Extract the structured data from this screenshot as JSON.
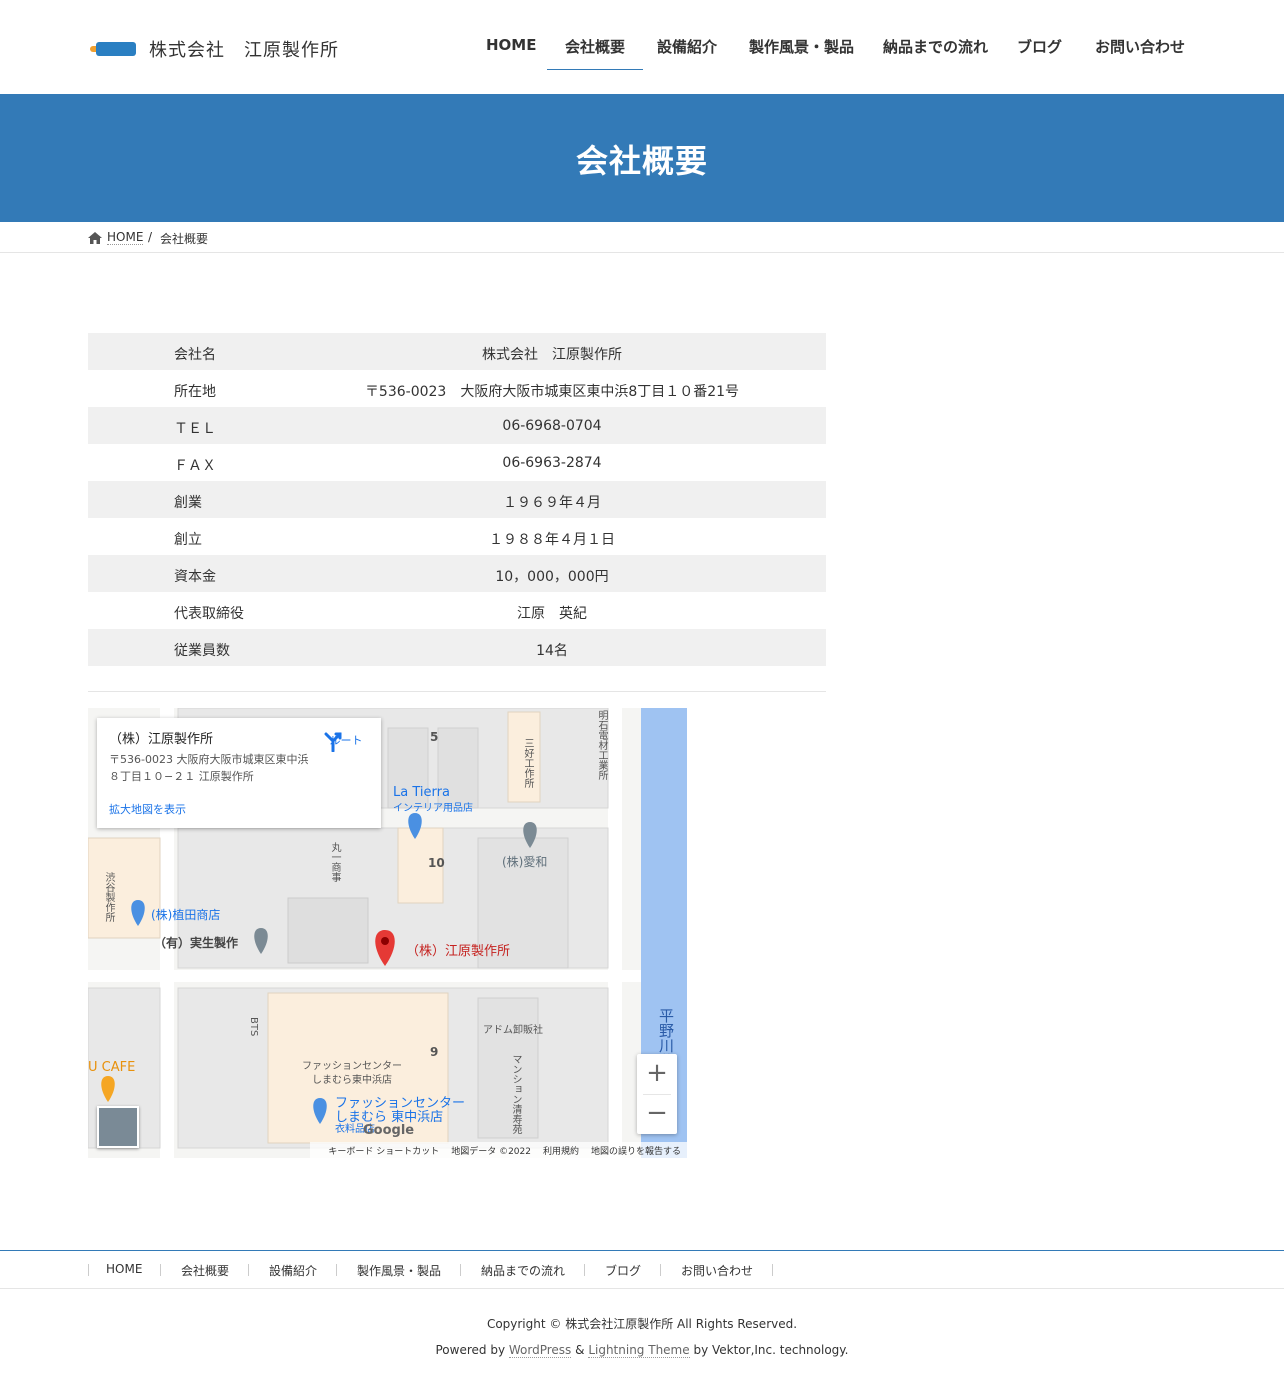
{
  "site": {
    "logo_text": "株式会社　江原製作所"
  },
  "nav": {
    "items": [
      {
        "label": "HOME"
      },
      {
        "label": "会社概要"
      },
      {
        "label": "設備紹介"
      },
      {
        "label": "製作風景・製品"
      },
      {
        "label": "納品までの流れ"
      },
      {
        "label": "ブログ"
      },
      {
        "label": "お問い合わせ"
      }
    ],
    "active": "会社概要"
  },
  "page_header": {
    "title": "会社概要"
  },
  "breadcrumb": {
    "home": "HOME",
    "separator": "/",
    "current": "会社概要"
  },
  "company_table": {
    "rows": [
      {
        "label": "会社名",
        "value": "株式会社　江原製作所"
      },
      {
        "label": "所在地",
        "value": "〒536-0023　大阪府大阪市城東区東中浜8丁目１０番21号"
      },
      {
        "label": "ＴＥＬ",
        "value": "06-6968-0704"
      },
      {
        "label": "ＦＡＸ",
        "value": "06-6963-2874"
      },
      {
        "label": "創業",
        "value": "１９６９年４月"
      },
      {
        "label": "創立",
        "value": "１９８８年４月１日"
      },
      {
        "label": "資本金",
        "value": "10，000，000円"
      },
      {
        "label": "代表取締役",
        "value": "江原　英紀"
      },
      {
        "label": "従業員数",
        "value": "14名"
      }
    ]
  },
  "map": {
    "card_title": "（株）江原製作所",
    "card_address": "〒536-0023 大阪府大阪市城東区東中浜８丁目１０−２１ 江原製作所",
    "card_link": "拡大地図を表示",
    "route_label": "ルート",
    "zoom_in": "+",
    "zoom_out": "−",
    "footer": {
      "keyboard": "キーボード ショートカット",
      "data": "地図データ ©2022",
      "terms": "利用規約",
      "report": "地図の誤りを報告する"
    },
    "google_logo": "Google",
    "places": {
      "main": "（株）江原製作所",
      "la_tierra": "La Tierra",
      "la_tierra_sub": "インテリア用品店",
      "aiwa": "(株)愛和",
      "ueda": "(株)植田商店",
      "jissei": "（有）実生製作",
      "fashion_center_1": "ファッションセンター",
      "fashion_center_2": "しまむら 東中浜店",
      "fashion_center_sub": "衣料品店",
      "fashion_bldg_1": "ファッションセンター",
      "fashion_bldg_2": "しまむら東中浜店",
      "adom": "アドム卸販社",
      "cafe": "U CAFE",
      "block_5": "5",
      "block_10": "10",
      "block_9": "9",
      "v_miyoshi": "三好工作所",
      "v_akashi": "明石電材工業所",
      "v_marui": "丸一商事",
      "v_shibutani": "渋谷製作所",
      "v_bts": "BTS",
      "v_mansion": "マンション清寿苑",
      "v_water": "平野川分水路"
    },
    "colors": {
      "water": "#9fc3f2",
      "pin": "#e53935",
      "gray_pin": "#7b8a94",
      "blue_pin": "#4a90e2",
      "orange_pin": "#f5a623"
    }
  },
  "footer_nav": {
    "items": [
      {
        "label": "HOME"
      },
      {
        "label": "会社概要"
      },
      {
        "label": "設備紹介"
      },
      {
        "label": "製作風景・製品"
      },
      {
        "label": "納品までの流れ"
      },
      {
        "label": "ブログ"
      },
      {
        "label": "お問い合わせ"
      }
    ]
  },
  "footer": {
    "copyright": "Copyright © 株式会社江原製作所 All Rights Reserved.",
    "powered_prefix": "Powered by ",
    "wordpress": "WordPress",
    "amp": " & ",
    "lightning": "Lightning Theme",
    "powered_suffix": " by Vektor,Inc. technology."
  },
  "theme": {
    "accent": "#337ab7"
  }
}
